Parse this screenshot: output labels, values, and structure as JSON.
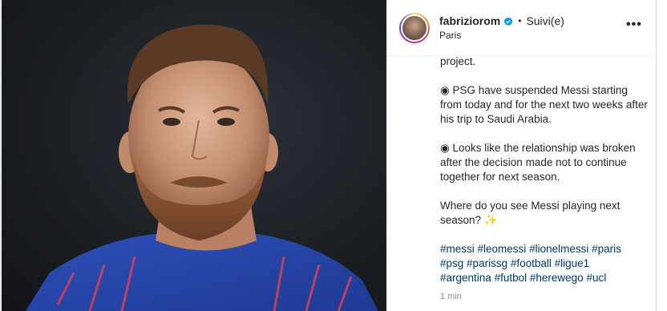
{
  "post": {
    "username": "fabriziorom",
    "separator": "•",
    "follow_status": "Suivi(e)",
    "location": "Paris",
    "more_label": "•••",
    "caption_top": "project.",
    "paragraph1": "◉ PSG have suspended Messi starting from today and for the next two weeks after his trip to Saudi Arabia.",
    "paragraph2": "◉ Looks like the relationship was broken after the decision made not to continue together for next season.",
    "paragraph3": "Where do you see Messi playing next season? ✨",
    "hashtags": [
      "#messi",
      "#leomessi",
      "#lionelmessi",
      "#paris",
      "#psg",
      "#parissg",
      "#football",
      "#ligue1",
      "#argentina",
      "#futbol",
      "#herewego",
      "#ucl"
    ],
    "time": "1 min"
  },
  "colors": {
    "verified": "#0095f6",
    "hashtag": "#00376b",
    "muted": "#8e8e8e"
  },
  "icons": {
    "verified": "verified-badge-icon",
    "more": "more-options-icon"
  }
}
